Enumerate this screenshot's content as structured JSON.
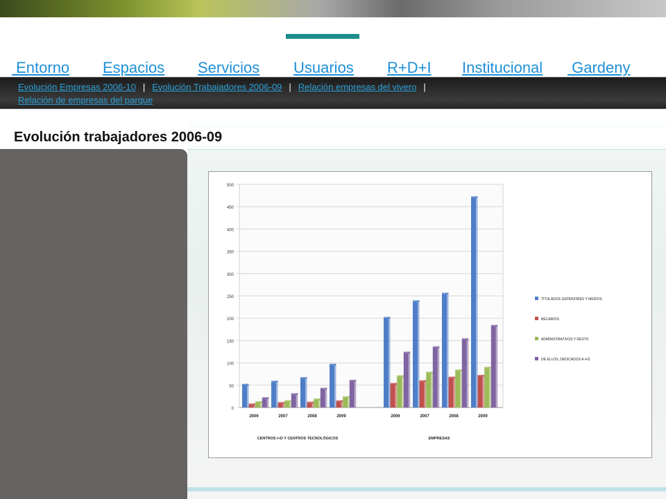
{
  "nav": {
    "items": [
      " Entorno",
      "Espacios",
      "Servicios",
      "Usuarios",
      "R+D+I",
      "Institucional",
      " Gardeny"
    ],
    "active": "Usuarios"
  },
  "subnav": {
    "links": [
      "Evolución Empresas 2006-10",
      "Evolución Trabajadores 2006-09",
      "Relación empresas del vivero",
      "Relación de empresas del parque"
    ],
    "separator": "|"
  },
  "page": {
    "title": "Evolución trabajadores 2006-09"
  },
  "colors": {
    "accent": "#1c8d8a",
    "link": "#1d8fd6",
    "sidebar": "#666363"
  },
  "chart_data": {
    "type": "bar",
    "groups": [
      "CENTROS I+D Y CENTROS TECNOLÓGICOS",
      "EMPRESAS"
    ],
    "categories": [
      "2006",
      "2007",
      "2008",
      "2009"
    ],
    "ylim": [
      0,
      500
    ],
    "yticks": [
      0,
      50,
      100,
      150,
      200,
      250,
      300,
      350,
      400,
      450,
      500
    ],
    "series": [
      {
        "name": "TITULADOS SUPERIORES Y MEDIOS",
        "color": "#4f7ec8",
        "values": [
          [
            50,
            57,
            65,
            95
          ],
          [
            200,
            237,
            254,
            470
          ]
        ]
      },
      {
        "name": "BECARIOS",
        "color": "#c0504d",
        "values": [
          [
            6,
            9,
            10,
            13
          ],
          [
            52,
            58,
            66,
            70
          ]
        ]
      },
      {
        "name": "ADMINISTRATIVOS Y RESTO",
        "color": "#9bbb59",
        "values": [
          [
            11,
            13,
            17,
            22
          ],
          [
            69,
            77,
            82,
            88
          ]
        ]
      },
      {
        "name": "DE ELLOS, DEDICADOS A I+D",
        "color": "#8064a2",
        "values": [
          [
            20,
            29,
            41,
            59
          ],
          [
            122,
            134,
            152,
            182
          ]
        ]
      }
    ]
  }
}
